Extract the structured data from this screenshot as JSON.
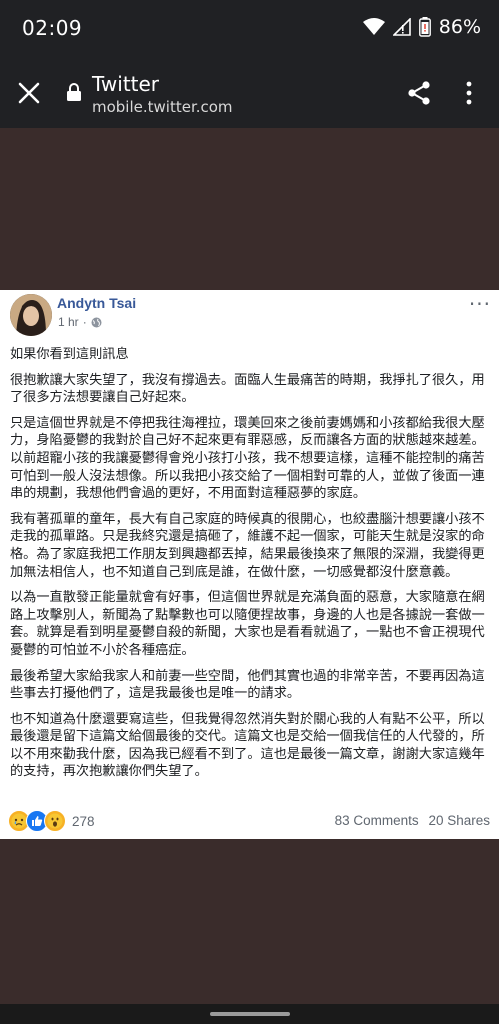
{
  "status_bar": {
    "time": "02:09",
    "battery": "86%"
  },
  "browser": {
    "title": "Twitter",
    "url": "mobile.twitter.com"
  },
  "post": {
    "author": "Andytn Tsai",
    "time": "1 hr",
    "more": "···",
    "paragraphs": [
      "如果你看到這則訊息",
      "很抱歉讓大家失望了，我沒有撐過去。面臨人生最痛苦的時期，我掙扎了很久，用了很多方法想要讓自己好起來。",
      "只是這個世界就是不停把我往海裡拉，環美回來之後前妻媽媽和小孩都給我很大壓力，身陷憂鬱的我對於自己好不起來更有罪惡感，反而讓各方面的狀態越來越差。以前超寵小孩的我讓憂鬱得會兇小孩打小孩，我不想要這樣，這種不能控制的痛苦可怕到一般人沒法想像。所以我把小孩交給了一個相對可靠的人，並做了後面一連串的規劃，我想他們會過的更好，不用面對這種惡夢的家庭。",
      "我有著孤單的童年，長大有自己家庭的時候真的很開心，也絞盡腦汁想要讓小孩不走我的孤單路。只是我終究還是搞砸了，維護不起一個家，可能天生就是沒家的命格。為了家庭我把工作朋友到興趣都丟掉，結果最後換來了無限的深淵，我變得更加無法相信人，也不知道自己到底是誰，在做什麼，一切感覺都沒什麼意義。",
      "以為一直散發正能量就會有好事，但這個世界就是充滿負面的惡意，大家隨意在網路上攻擊別人，新聞為了點擊數也可以隨便捏故事，身邊的人也是各據說一套做一套。就算是看到明星憂鬱自殺的新聞，大家也是看看就過了，一點也不會正視現代憂鬱的可怕並不小於各種癌症。",
      "最後希望大家給我家人和前妻一些空間，他們其實也過的非常辛苦，不要再因為這些事去打擾他們了，這是我最後也是唯一的請求。",
      "也不知道為什麼還要寫這些，但我覺得忽然消失對於關心我的人有點不公平，所以最後還是留下這篇文給個最後的交代。這篇文也是交給一個我信任的人代發的，所以不用來勸我什麼，因為我已經看不到了。這也是最後一篇文章，謝謝大家這幾年的支持，再次抱歉讓你們失望了。"
    ],
    "reaction_count": "278",
    "comments": "83 Comments",
    "shares": "20 Shares"
  },
  "colors": {
    "author": "#385898",
    "page_bg": "#3a2c2b",
    "bar_bg": "#202124"
  }
}
